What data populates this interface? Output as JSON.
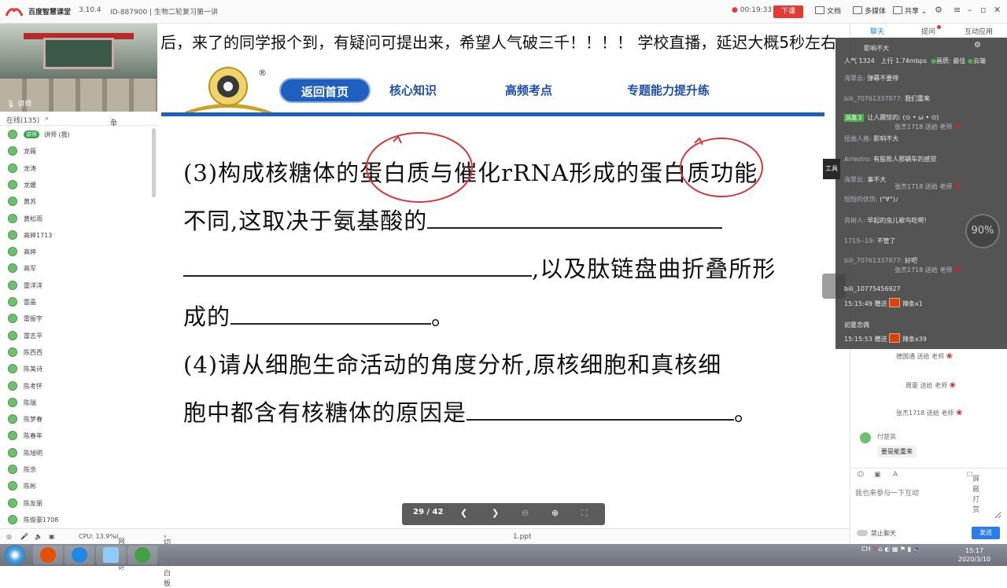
{
  "topbar": {
    "app_name": "百度智慧课堂",
    "version": "3.10.4",
    "room_info": "ID-887900 | 生物二轮复习第一讲",
    "timer": "00:19:33",
    "end_class": "下课",
    "tools": [
      "文档",
      "多媒体",
      "共享"
    ]
  },
  "left": {
    "webcam_label": "讲师",
    "online_label": "在线(135)",
    "raise_label": "举手连线",
    "users": [
      "讲师 (我)",
      "龙薇",
      "龙涛",
      "龙媛",
      "黄苏",
      "黄松雨",
      "高婷1713",
      "高婷",
      "高军",
      "雷洋洋",
      "雷晶",
      "雷振宇",
      "雷志平",
      "陈西西",
      "陈美诗",
      "陈考怀",
      "陈瑞",
      "陈梦春",
      "陈春年",
      "陈旭明",
      "陈余",
      "陈彬",
      "陈友丽",
      "陈俊豪1708"
    ],
    "cpu": "CPU: 13.9%",
    "network": "网络良好"
  },
  "marquee": "后，来了的同学报个到，有疑问可提出来，希望人气破三千！！！！  学校直播，延迟大概5秒左右",
  "slide": {
    "nav": [
      "返回首页",
      "核心知识",
      "高频考点",
      "专题能力提升练"
    ],
    "lines": [
      "(3)构成核糖体的蛋白质与催化rRNA形成的蛋白质功能",
      "不同,这取决于氨基酸的",
      ",以及肽链盘曲折叠所形",
      "成的",
      "(4)请从细胞生命活动的角度分析,原核细胞和真核细",
      "胞中都含有核糖体的原因是"
    ],
    "end_mark": "。"
  },
  "slide_toolbar": {
    "page": "29 / 42"
  },
  "pagebar": {
    "switch": "切换到白板",
    "file": "1.ppt"
  },
  "right": {
    "tabs": [
      "聊天",
      "提问",
      "互动应用"
    ],
    "gifts": [
      {
        "name": "张杰1718",
        "verb": "送给",
        "to": "老师"
      },
      {
        "name": "德国通",
        "verb": "送给",
        "to": "老师"
      },
      {
        "name": "周豪",
        "verb": "送给",
        "to": "老师"
      },
      {
        "name": "张杰1718",
        "verb": "送给",
        "to": "老师"
      }
    ],
    "msg_name": "付楚英",
    "msg_text": "要是能重来",
    "tools": [
      "☺",
      "▣",
      "A",
      "屏蔽打赏"
    ],
    "input_placeholder": "我也来参与一下互动",
    "mute": "禁止聊天",
    "send": "发送"
  },
  "overlay": {
    "top": "影响不大",
    "stats": {
      "popularity": "人气  1324",
      "upload": "上行  1.74mbps",
      "quality": "画质: 最佳",
      "cloud": "云端"
    },
    "messages": [
      {
        "name": "海翠云:",
        "text": "弹幕不要停"
      },
      {
        "name": "bili_70761337877:",
        "text": "我们重来"
      },
      {
        "name": "",
        "text": "让人震惊的: (⊙ • ω • ⊙)",
        "badge": "凤凰 2"
      },
      {
        "name": "扭曲人格:",
        "text": "影响不大"
      },
      {
        "name": "Arrestro:",
        "text": "有股败人那辆车的感觉"
      },
      {
        "name": "海翠云:",
        "text": "事不大"
      },
      {
        "name": "短短的优伤:",
        "text": "(°∀°)ﾉ"
      },
      {
        "name": "肖树人:",
        "text": "早起的虫儿被鸟吃啊！"
      },
      {
        "name": "1715--19:",
        "text": "不管了"
      },
      {
        "name": "bili_70761337877:",
        "text": "好吧"
      }
    ],
    "gifts": [
      {
        "user": "bili_10775456927",
        "time": "15:15:49 赠送",
        "item": "辣条x1"
      },
      {
        "user": "初夏恋偶",
        "time": "15:15:53 赠送",
        "item": "辣条x39"
      }
    ],
    "speed": "90%",
    "tool_tab": "工具"
  },
  "taskbar": {
    "tray": "CH",
    "time": "15:17",
    "date": "2020/3/10"
  }
}
